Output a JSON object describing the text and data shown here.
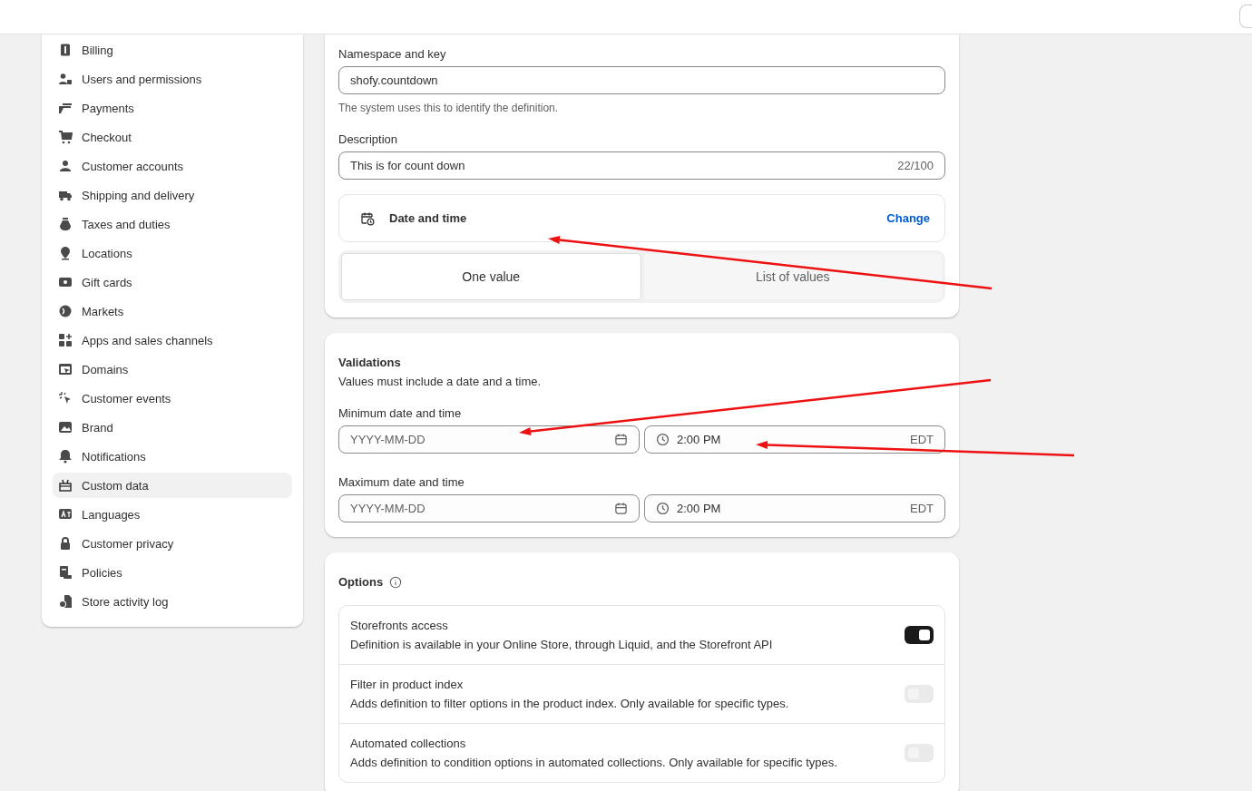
{
  "sidebar": {
    "items": [
      {
        "label": "Billing",
        "selected": false
      },
      {
        "label": "Users and permissions",
        "selected": false
      },
      {
        "label": "Payments",
        "selected": false
      },
      {
        "label": "Checkout",
        "selected": false
      },
      {
        "label": "Customer accounts",
        "selected": false
      },
      {
        "label": "Shipping and delivery",
        "selected": false
      },
      {
        "label": "Taxes and duties",
        "selected": false
      },
      {
        "label": "Locations",
        "selected": false
      },
      {
        "label": "Gift cards",
        "selected": false
      },
      {
        "label": "Markets",
        "selected": false
      },
      {
        "label": "Apps and sales channels",
        "selected": false
      },
      {
        "label": "Domains",
        "selected": false
      },
      {
        "label": "Customer events",
        "selected": false
      },
      {
        "label": "Brand",
        "selected": false
      },
      {
        "label": "Notifications",
        "selected": false
      },
      {
        "label": "Custom data",
        "selected": true
      },
      {
        "label": "Languages",
        "selected": false
      },
      {
        "label": "Customer privacy",
        "selected": false
      },
      {
        "label": "Policies",
        "selected": false
      },
      {
        "label": "Store activity log",
        "selected": false
      }
    ]
  },
  "definition": {
    "namespace_field": {
      "label": "Namespace and key",
      "value": "shofy.countdown",
      "help": "The system uses this to identify the definition."
    },
    "description_field": {
      "label": "Description",
      "value": "This is for count down",
      "counter": "22/100"
    },
    "type": {
      "label": "Date and time",
      "action": "Change"
    },
    "value_mode": [
      {
        "label": "One value",
        "selected": true
      },
      {
        "label": "List of values",
        "selected": false
      }
    ]
  },
  "validations": {
    "title": "Validations",
    "description": "Values must include a date and a time.",
    "ranges": [
      {
        "label": "Minimum date and time",
        "date_placeholder": "YYYY-MM-DD",
        "time_value": "2:00 PM",
        "timezone": "EDT"
      },
      {
        "label": "Maximum date and time",
        "date_placeholder": "YYYY-MM-DD",
        "time_value": "2:00 PM",
        "timezone": "EDT"
      }
    ]
  },
  "options": {
    "title": "Options",
    "items": [
      {
        "title": "Storefronts access",
        "description": "Definition is available in your Online Store, through Liquid, and the Storefront API",
        "on": true
      },
      {
        "title": "Filter in product index",
        "description": "Adds definition to filter options in the product index. Only available for specific types.",
        "on": false
      },
      {
        "title": "Automated collections",
        "description": "Adds definition to condition options in automated collections. Only available for specific types.",
        "on": false
      }
    ]
  }
}
